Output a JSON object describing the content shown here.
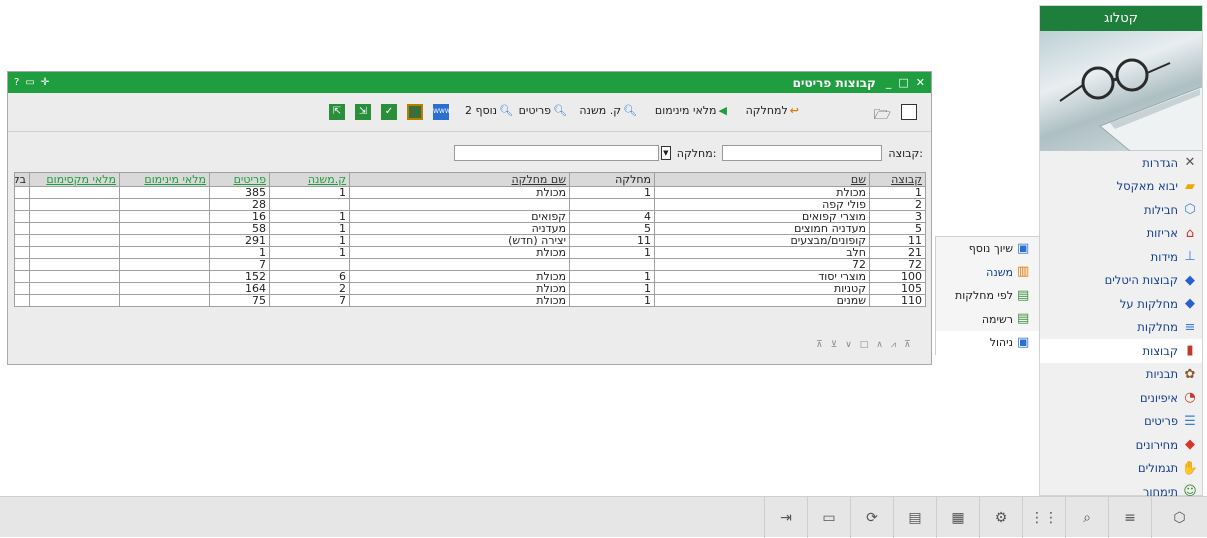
{
  "catalog": {
    "title": "קטלוג",
    "items": [
      {
        "label": "הגדרות",
        "icon": "settings-wrench-icon",
        "selected": false
      },
      {
        "label": "יבוא מאקסל",
        "icon": "folder-import-icon",
        "selected": false
      },
      {
        "label": "חבילות",
        "icon": "cube-icon",
        "selected": false
      },
      {
        "label": "אריזות",
        "icon": "gift-box-icon",
        "selected": false
      },
      {
        "label": "מידות",
        "icon": "ruler-icon",
        "selected": false
      },
      {
        "label": "קבוצות היטלים",
        "icon": "diamond-blue-icon",
        "selected": false
      },
      {
        "label": "מחלקות על",
        "icon": "diamond-blue-icon",
        "selected": false
      },
      {
        "label": "מחלקות",
        "icon": "lines-icon",
        "selected": false
      },
      {
        "label": "קבוצות",
        "icon": "binders-icon",
        "selected": true
      },
      {
        "label": "תבניות",
        "icon": "flower-icon",
        "selected": false
      },
      {
        "label": "איפיונים",
        "icon": "chart-pie-icon",
        "selected": false
      },
      {
        "label": "פריטים",
        "icon": "list-icon",
        "selected": false
      },
      {
        "label": "מחירונים",
        "icon": "price-tag-icon",
        "selected": false
      },
      {
        "label": "תגמולים",
        "icon": "hand-gift-icon",
        "selected": false
      },
      {
        "label": "תימחור",
        "icon": "person-icon",
        "selected": false
      }
    ]
  },
  "submenu": {
    "items": [
      {
        "label": "שיוך נוסף",
        "icon": "monitor-edit-icon",
        "blue": false,
        "selected": false
      },
      {
        "label": "משנה",
        "icon": "bar-chart-icon",
        "blue": true,
        "selected": false
      },
      {
        "label": "לפי מחלקות",
        "icon": "table-icon",
        "blue": false,
        "selected": false
      },
      {
        "label": "רשימה",
        "icon": "table-icon",
        "blue": false,
        "selected": false
      },
      {
        "label": "ניהול",
        "icon": "monitor-edit-icon",
        "blue": false,
        "selected": true
      }
    ]
  },
  "window": {
    "title": "קבוצות פריטים",
    "toolbar": {
      "to_department": "למחלקה",
      "fill_minimum": "מלאי מינימום",
      "sub_group": "ק. משנה",
      "items": "פריטים",
      "extra2": "נוסף 2"
    },
    "filters": {
      "group_label": "קבוצה:",
      "department_label": "מחלקה:"
    },
    "columns": [
      "קבוצה",
      "שם",
      "מחלקה",
      "שם מחלקה",
      "ק.משנה",
      "פריטים",
      "מלאי מינימום",
      "מלאי מקסימום",
      "בקופה"
    ],
    "rows": [
      [
        "1",
        "מכולת",
        "1",
        "מכולת",
        "1",
        "385",
        "",
        "",
        ""
      ],
      [
        "2",
        "פולי קפה",
        "",
        "",
        "",
        "28",
        "",
        "",
        ""
      ],
      [
        "3",
        "מוצרי קפואים",
        "4",
        "קפואים",
        "1",
        "16",
        "",
        "",
        ""
      ],
      [
        "5",
        "מעדניה חמוצים",
        "5",
        "מעדניה",
        "1",
        "58",
        "",
        "",
        ""
      ],
      [
        "11",
        "קופונים/מבצעים",
        "11",
        "יצירה (חדש)",
        "1",
        "291",
        "",
        "",
        ""
      ],
      [
        "21",
        "חלב",
        "1",
        "מכולת",
        "1",
        "1",
        "",
        "",
        ""
      ],
      [
        "72",
        "72",
        "",
        "",
        "",
        "7",
        "",
        "",
        ""
      ],
      [
        "100",
        "מוצרי יסוד",
        "1",
        "מכולת",
        "6",
        "152",
        "",
        "",
        ""
      ],
      [
        "105",
        "קטניות",
        "1",
        "מכולת",
        "2",
        "164",
        "",
        "",
        ""
      ],
      [
        "110",
        "שמנים",
        "1",
        "מכולת",
        "7",
        "75",
        "",
        "",
        ""
      ]
    ]
  },
  "colors": {
    "title_green": "#1e9e3e",
    "catalog_header": "#1e7f3c",
    "link_blue": "#123d8c"
  }
}
